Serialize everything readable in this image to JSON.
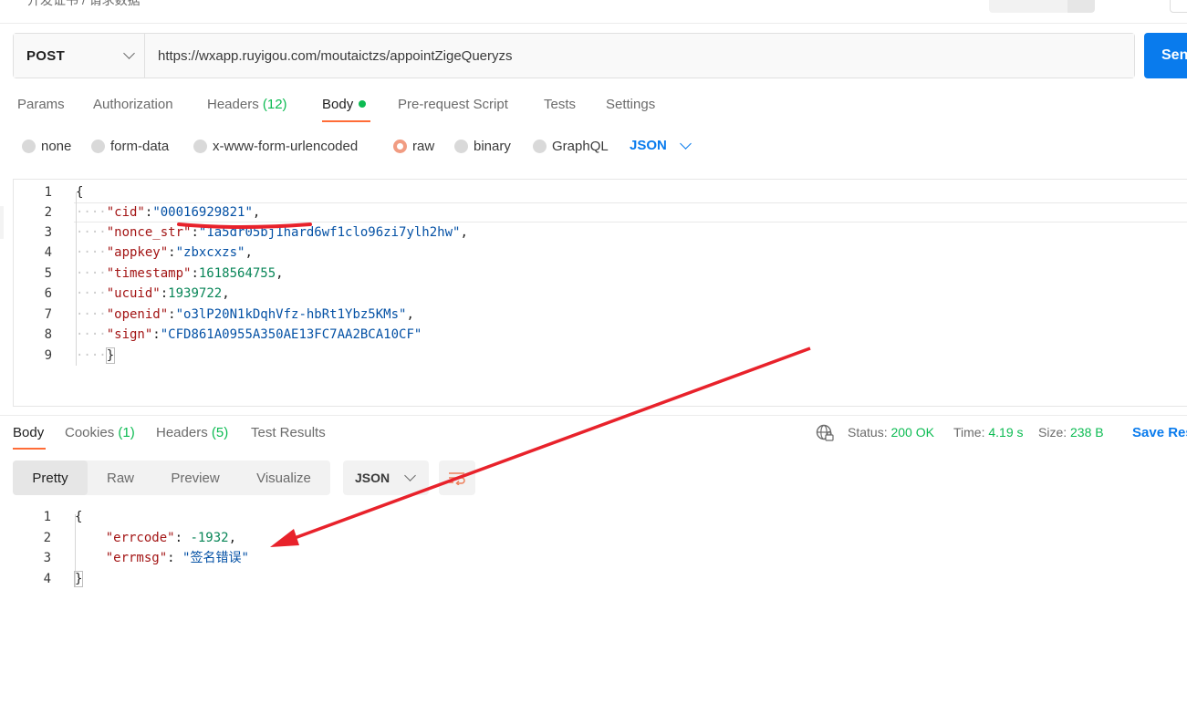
{
  "top": {
    "breadcrumb": "开发证书 / 请求数据"
  },
  "request": {
    "method": "POST",
    "url": "https://wxapp.ruyigou.com/moutaictzs/appointZigeQueryzs",
    "send_label": "Send"
  },
  "request_tabs": {
    "params": "Params",
    "authorization": "Authorization",
    "headers": "Headers",
    "headers_count": "(12)",
    "body": "Body",
    "pre_request": "Pre-request Script",
    "tests": "Tests",
    "settings": "Settings"
  },
  "body_types": {
    "none": "none",
    "form_data": "form-data",
    "urlencoded": "x-www-form-urlencoded",
    "raw": "raw",
    "binary": "binary",
    "graphql": "GraphQL",
    "selected": "raw",
    "format": "JSON"
  },
  "request_body": {
    "line_numbers": [
      "1",
      "2",
      "3",
      "4",
      "5",
      "6",
      "7",
      "8",
      "9"
    ],
    "open_brace": "{",
    "close_brace": "}",
    "indent": "····",
    "fields": [
      {
        "key": "\"cid\"",
        "value": "\"00016929821\"",
        "type": "string",
        "comma": ","
      },
      {
        "key": "\"nonce_str\"",
        "value": "\"1a5dr05bj1hard6wf1clo96zi7ylh2hw\"",
        "type": "string",
        "comma": ","
      },
      {
        "key": "\"appkey\"",
        "value": "\"zbxcxzs\"",
        "type": "string",
        "comma": ","
      },
      {
        "key": "\"timestamp\"",
        "value": "1618564755",
        "type": "number",
        "comma": ","
      },
      {
        "key": "\"ucuid\"",
        "value": "1939722",
        "type": "number",
        "comma": ","
      },
      {
        "key": "\"openid\"",
        "value": "\"o3lP20N1kDqhVfz-hbRt1Ybz5KMs\"",
        "type": "string",
        "comma": ","
      },
      {
        "key": "\"sign\"",
        "value": "\"CFD861A0955A350AE13FC7AA2BCA10CF\"",
        "type": "string",
        "comma": ""
      }
    ]
  },
  "response_tabs": {
    "body": "Body",
    "cookies": "Cookies",
    "cookies_count": "(1)",
    "headers": "Headers",
    "headers_count": "(5)",
    "test_results": "Test Results"
  },
  "response_status": {
    "status_label": "Status:",
    "status_value": "200 OK",
    "time_label": "Time:",
    "time_value": "4.19 s",
    "size_label": "Size:",
    "size_value": "238 B",
    "save_label": "Save Response"
  },
  "view_modes": {
    "pretty": "Pretty",
    "raw": "Raw",
    "preview": "Preview",
    "visualize": "Visualize",
    "active": "Pretty",
    "format": "JSON"
  },
  "response_body": {
    "line_numbers": [
      "1",
      "2",
      "3",
      "4"
    ],
    "open_brace": "{",
    "close_brace": "}",
    "fields": [
      {
        "key": "\"errcode\"",
        "value": "-1932",
        "type": "number",
        "comma": ","
      },
      {
        "key": "\"errmsg\"",
        "value": "\"签名错误\"",
        "type": "string",
        "comma": ""
      }
    ]
  },
  "colors": {
    "accent_orange": "#ff6c37",
    "brand_blue": "#097bed",
    "success_green": "#0cbb52",
    "annotation_red": "#e8222b"
  },
  "icons": {
    "method_dropdown": "chevron-down-icon",
    "format_dropdown": "chevron-down-icon",
    "globe": "globe-lock-icon",
    "wrap": "wrap-lines-icon"
  }
}
